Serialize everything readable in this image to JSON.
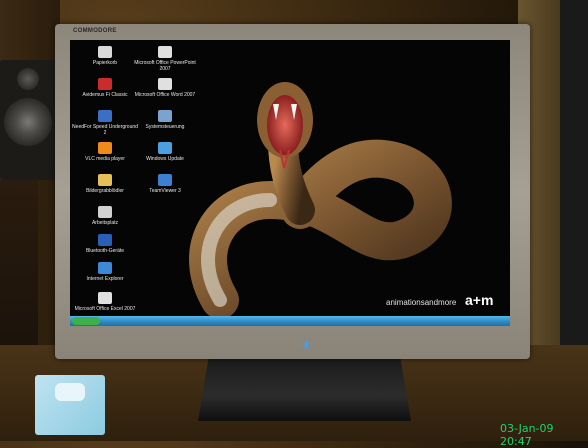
{
  "monitor": {
    "brand": "COMMODORE"
  },
  "desktop": {
    "icons": [
      {
        "label": "Papierkorb",
        "color": "#d9d9d9"
      },
      {
        "label": "Microsoft Office PowerPoint 2007",
        "color": "#e0e0e0"
      },
      {
        "label": "Avidemux Fi Classic",
        "color": "#cc2b2b"
      },
      {
        "label": "Microsoft Office Word 2007",
        "color": "#e0e0e0"
      },
      {
        "label": "NeedFor Speed Underground 2",
        "color": "#3a6fc4"
      },
      {
        "label": "Systemsteuerung",
        "color": "#7aa4cf"
      },
      {
        "label": "VLC media player",
        "color": "#f08a1a"
      },
      {
        "label": "Windows Update",
        "color": "#4aa0e0"
      },
      {
        "label": "Bildergrabblödler",
        "color": "#e6c15a"
      },
      {
        "label": "TeamViewer 3",
        "color": "#3d7fd1"
      },
      {
        "label": "Arbeitsplatz",
        "color": "#d0d0d0"
      },
      {
        "label": "Bluetooth-Geräte",
        "color": "#2a5fb8"
      },
      {
        "label": "Internet Explorer",
        "color": "#3c8ad6"
      },
      {
        "label": "Microsoft Office Excel 2007",
        "color": "#e0e0e0"
      }
    ],
    "wallpaper_brand": "animationsandmore",
    "wallpaper_logo": "a+m"
  },
  "photo": {
    "timestamp": "03-Jan-09 20:47"
  }
}
